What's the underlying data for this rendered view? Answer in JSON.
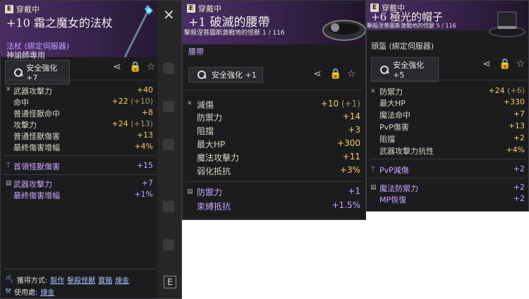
{
  "panel1": {
    "worn": "穿戴中",
    "title": "+10 霜之魔女的法杖",
    "type_line": "法杖 (綁定伺服器)",
    "class_line": "神諭師專用",
    "enhance": "安全強化 +7",
    "stats_a": [
      {
        "label": "武器攻擊力",
        "value": "+40",
        "extra": ""
      },
      {
        "label": "命中",
        "value": "+22",
        "extra": "(+10)"
      },
      {
        "label": "普通怪獸命中",
        "value": "+8",
        "extra": ""
      },
      {
        "label": "攻擊力",
        "value": "+24",
        "extra": "(+13)"
      },
      {
        "label": "普通怪獸傷害",
        "value": "+13",
        "extra": ""
      },
      {
        "label": "最終傷害增幅",
        "value": "+4%",
        "extra": ""
      }
    ],
    "stats_b": [
      {
        "label": "首領怪獸傷害",
        "value": "+15"
      }
    ],
    "stats_c": [
      {
        "label": "武器攻擊力",
        "value": "+7"
      },
      {
        "label": "最終傷害增幅",
        "value": "+1%"
      }
    ],
    "acquire_label": "獲得方式:",
    "acquire_links": [
      "製作",
      "擊殺怪獸",
      "寶箱",
      "煉金"
    ],
    "use_label": "使用處:",
    "use_links": [
      "煉金"
    ]
  },
  "panel2": {
    "worn": "穿戴中",
    "title": "+1 破滅的腰帶",
    "sub": "擊殺涅普圖斯激戰地的怪獸 1 / 116",
    "type": "腰帶",
    "enhance": "安全強化 +1",
    "stats_a": [
      {
        "label": "減傷",
        "value": "+10",
        "extra": "(+1)"
      },
      {
        "label": "防禦力",
        "value": "+14",
        "extra": ""
      },
      {
        "label": "阻擋",
        "value": "+3",
        "extra": ""
      },
      {
        "label": "最大HP",
        "value": "+300",
        "extra": ""
      },
      {
        "label": "魔法攻擊力",
        "value": "+11",
        "extra": ""
      },
      {
        "label": "弱化抵抗",
        "value": "+3%",
        "extra": ""
      }
    ],
    "stats_b": [
      {
        "label": "防禦力",
        "value": "+1"
      },
      {
        "label": "束縛抵抗",
        "value": "+1.5%"
      }
    ]
  },
  "panel3": {
    "worn": "穿戴中",
    "title": "+6 極光的帽子",
    "sub": "擊殺涅普圖斯激戰地的怪獸 5 / 116",
    "type": "頭盔 (綁定伺服器)",
    "enhance": "安全強化 +5",
    "stats_a": [
      {
        "label": "防禦力",
        "value": "+24",
        "extra": "(+6)"
      },
      {
        "label": "最大HP",
        "value": "+330",
        "extra": ""
      },
      {
        "label": "魔法命中",
        "value": "+7",
        "extra": ""
      },
      {
        "label": "PvP傷害",
        "value": "+13",
        "extra": ""
      },
      {
        "label": "阻擋",
        "value": "+2",
        "extra": ""
      },
      {
        "label": "武器攻擊力抗性",
        "value": "+4%",
        "extra": ""
      }
    ],
    "stats_b": [
      {
        "label": "PvP減傷",
        "value": "+2"
      }
    ],
    "stats_c": [
      {
        "label": "魔法防禦力",
        "value": "+2"
      },
      {
        "label": "MP恢復",
        "value": "+2"
      }
    ]
  },
  "side_icons": [
    "close-icon",
    "book-icon",
    "scales-icon",
    "box-icon",
    "scroll-icon",
    "cup-icon",
    "e-key-icon"
  ],
  "e_key": "E",
  "close_glyph": "✕"
}
